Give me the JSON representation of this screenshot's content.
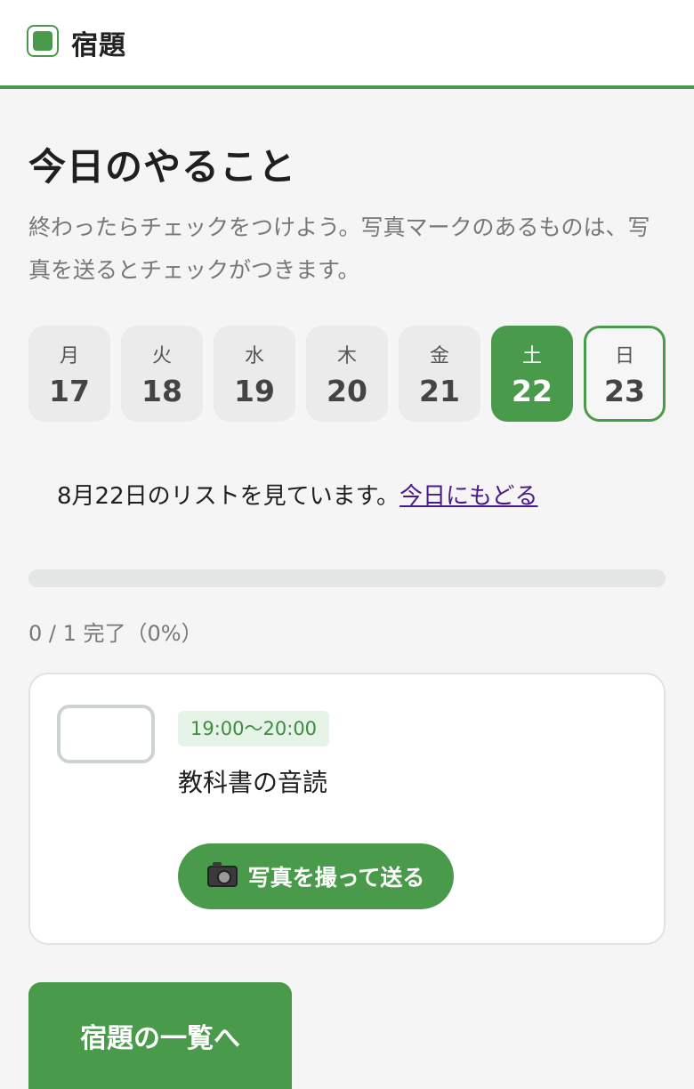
{
  "header": {
    "title": "宿題"
  },
  "main": {
    "title": "今日のやること",
    "description": "終わったらチェックをつけよう。写真マークのあるものは、写真を送るとチェックがつきます。"
  },
  "days": [
    {
      "dow": "月",
      "num": "17",
      "state": "normal"
    },
    {
      "dow": "火",
      "num": "18",
      "state": "normal"
    },
    {
      "dow": "水",
      "num": "19",
      "state": "normal"
    },
    {
      "dow": "木",
      "num": "20",
      "state": "normal"
    },
    {
      "dow": "金",
      "num": "21",
      "state": "normal"
    },
    {
      "dow": "土",
      "num": "22",
      "state": "selected"
    },
    {
      "dow": "日",
      "num": "23",
      "state": "today"
    }
  ],
  "viewing": {
    "text": "8月22日のリストを見ています。",
    "link": "今日にもどる"
  },
  "progress": {
    "completed": 0,
    "total": 1,
    "label": "0 / 1 完了（0%）"
  },
  "task": {
    "time": "19:00〜20:00",
    "title": "教科書の音読",
    "photo_button": "写真を撮って送る"
  },
  "footer": {
    "list_button": "宿題の一覧へ"
  },
  "colors": {
    "accent": "#4a9a4c",
    "link": "#4a1a8c"
  }
}
